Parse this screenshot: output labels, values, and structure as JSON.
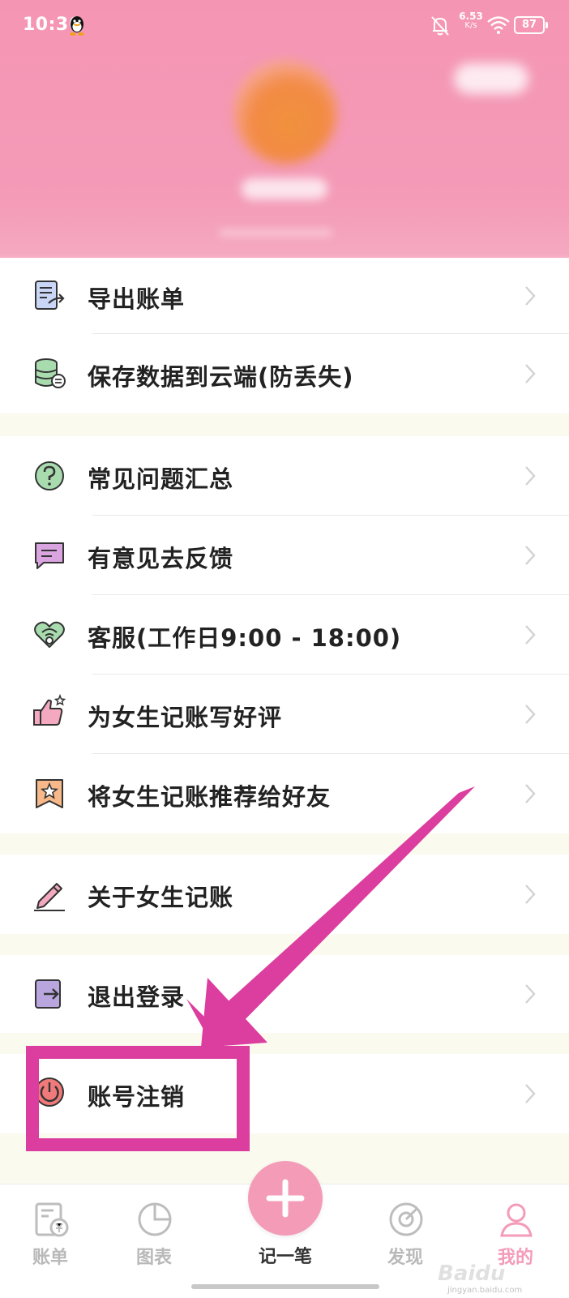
{
  "status_bar": {
    "time": "10:36",
    "net_speed": "6.53",
    "net_unit": "K/s",
    "battery": "87"
  },
  "menu": [
    {
      "label": "导出账单",
      "icon": "export-bill-icon"
    },
    {
      "label": "保存数据到云端(防丢失)",
      "icon": "cloud-database-icon"
    },
    {
      "label": "常见问题汇总",
      "icon": "question-icon"
    },
    {
      "label": "有意见去反馈",
      "icon": "feedback-icon"
    },
    {
      "label": "客服(工作日9:00 - 18:00)",
      "icon": "customer-service-icon"
    },
    {
      "label": "为女生记账写好评",
      "icon": "thumbs-up-icon"
    },
    {
      "label": "将女生记账推荐给好友",
      "icon": "recommend-icon"
    },
    {
      "label": "关于女生记账",
      "icon": "pencil-icon"
    },
    {
      "label": "退出登录",
      "icon": "logout-icon"
    },
    {
      "label": "账号注销",
      "icon": "power-icon"
    }
  ],
  "tabbar": {
    "tabs": [
      {
        "label": "账单",
        "icon": "bill-icon"
      },
      {
        "label": "图表",
        "icon": "pie-chart-icon"
      },
      {
        "label": "记一笔",
        "icon": "plus-icon"
      },
      {
        "label": "发现",
        "icon": "discover-icon"
      },
      {
        "label": "我的",
        "icon": "profile-icon"
      }
    ]
  },
  "colors": {
    "header_pink": "#f49bb8",
    "highlight_magenta": "#db3e9e",
    "page_bg": "#fbfaef"
  },
  "watermark": {
    "brand": "Baidu",
    "sub": "jingyan.baidu.com"
  }
}
